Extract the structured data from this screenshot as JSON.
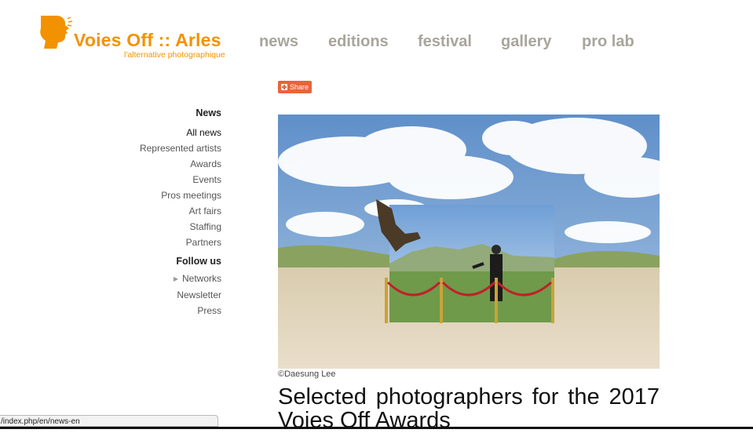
{
  "logo": {
    "brand": "Voies Off :: Arles",
    "tagline": "l'alternative photographique",
    "icon": "profile-head-icon",
    "color": "#f39200"
  },
  "topnav": {
    "items": [
      "news",
      "editions",
      "festival",
      "gallery",
      "pro lab"
    ],
    "color": "#a8a59c"
  },
  "share": {
    "label": "Share",
    "color": "#e8643c"
  },
  "sidebar": {
    "news_heading": "News",
    "news_items": [
      "All news",
      "Represented artists",
      "Awards",
      "Events",
      "Pros meetings",
      "Art fairs",
      "Staffing",
      "Partners"
    ],
    "follow_heading": "Follow us",
    "follow_items": [
      "Networks",
      "Newsletter",
      "Press"
    ]
  },
  "article": {
    "image_alt": "Eagle hunter in desert with framed landscape backdrop",
    "credit": "©Daesung Lee",
    "title_line1": "Selected photographers for the 2017",
    "title_line2": "Voies Off Awards"
  },
  "statusbar": {
    "url": "/index.php/en/news-en"
  }
}
